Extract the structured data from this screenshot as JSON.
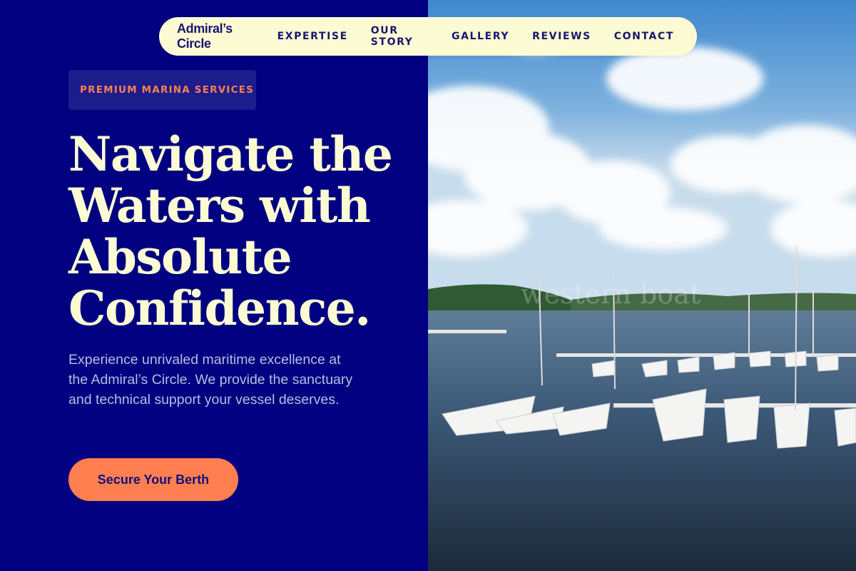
{
  "brand": "Admiral’s Circle",
  "nav": {
    "links": [
      "EXPERTISE",
      "OUR STORY",
      "GALLERY",
      "REVIEWS",
      "CONTACT"
    ]
  },
  "hero": {
    "eyebrow": "PREMIUM MARINA SERVICES",
    "headline": [
      "Navigate the",
      "Waters with",
      "Absolute",
      "Confidence."
    ],
    "description": "Experience unrivaled maritime excellence at the Admiral’s Circle. We provide the sanctuary and technical support your vessel deserves.",
    "cta_label": "Secure Your Berth"
  },
  "image": {
    "subject": "marina-photo",
    "watermark": "western boat"
  },
  "colors": {
    "background": "#000080",
    "nav_bg": "#fcfbd3",
    "accent": "#ff7f50",
    "headline": "#fcfbd3",
    "body_text": "#b9bce0"
  }
}
